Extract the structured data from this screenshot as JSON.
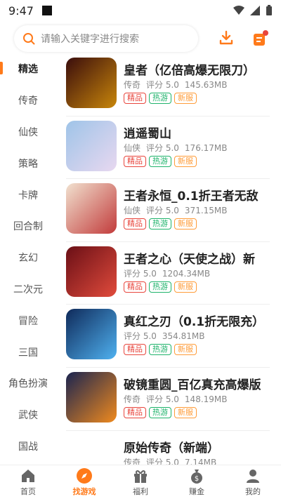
{
  "status": {
    "time": "9:47"
  },
  "search": {
    "placeholder": "请输入关键字进行搜索"
  },
  "sidebar": {
    "items": [
      {
        "label": "精选",
        "active": true
      },
      {
        "label": "传奇"
      },
      {
        "label": "仙侠"
      },
      {
        "label": "策略"
      },
      {
        "label": "卡牌"
      },
      {
        "label": "回合制"
      },
      {
        "label": "玄幻"
      },
      {
        "label": "二次元"
      },
      {
        "label": "冒险"
      },
      {
        "label": "三国"
      },
      {
        "label": "角色扮演"
      },
      {
        "label": "武侠"
      },
      {
        "label": "国战"
      }
    ]
  },
  "games": [
    {
      "title": "皇者（亿倍高爆无限刀）",
      "genre": "传奇",
      "rating": "评分 5.0",
      "size": "145.63MB",
      "tags": [
        "精品",
        "热游",
        "新服"
      ],
      "icon_colors": [
        "#3a0d0d",
        "#c8860a"
      ]
    },
    {
      "title": "逍遥蜀山",
      "genre": "仙侠",
      "rating": "评分 5.0",
      "size": "176.17MB",
      "tags": [
        "精品",
        "热游",
        "新服"
      ],
      "icon_colors": [
        "#9fc4e8",
        "#e8d8f0"
      ]
    },
    {
      "title": "王者永恒_0.1折王者无敌",
      "genre": "仙侠",
      "rating": "评分 5.0",
      "size": "371.15MB",
      "tags": [
        "精品",
        "热游",
        "新服"
      ],
      "icon_colors": [
        "#f1e1cf",
        "#c23b3b"
      ]
    },
    {
      "title": "王者之心（天使之战）新",
      "genre": "",
      "rating": "评分 5.0",
      "size": "1204.34MB",
      "tags": [
        "精品",
        "热游",
        "新服"
      ],
      "icon_colors": [
        "#6a0f16",
        "#e14b3c"
      ]
    },
    {
      "title": "真红之刃（0.1折无限充）",
      "genre": "",
      "rating": "评分 5.0",
      "size": "354.81MB",
      "tags": [
        "精品",
        "热游",
        "新服"
      ],
      "icon_colors": [
        "#0f2a5a",
        "#4fb1f0"
      ]
    },
    {
      "title": "破镜重圆_百亿真充高爆版",
      "genre": "传奇",
      "rating": "评分 5.0",
      "size": "148.19MB",
      "tags": [
        "精品",
        "热游",
        "新服"
      ],
      "icon_colors": [
        "#1a2450",
        "#f08a1e"
      ]
    },
    {
      "title": "原始传奇（新端）",
      "genre": "传奇",
      "rating": "评分 5.0",
      "size": "7.14MB",
      "tags": [],
      "icon_colors": [
        "#ffffff",
        "#ffffff"
      ]
    }
  ],
  "tabbar": {
    "items": [
      {
        "label": "首页",
        "icon": "home-icon"
      },
      {
        "label": "找游戏",
        "icon": "compass-icon",
        "active": true
      },
      {
        "label": "福利",
        "icon": "gift-icon"
      },
      {
        "label": "赚金",
        "icon": "money-bag-icon"
      },
      {
        "label": "我的",
        "icon": "person-icon"
      }
    ]
  },
  "colors": {
    "accent": "#ff7a1a",
    "tag_red": "#e8453c",
    "tag_green": "#1fb36b",
    "tag_orange": "#ff9c39"
  }
}
